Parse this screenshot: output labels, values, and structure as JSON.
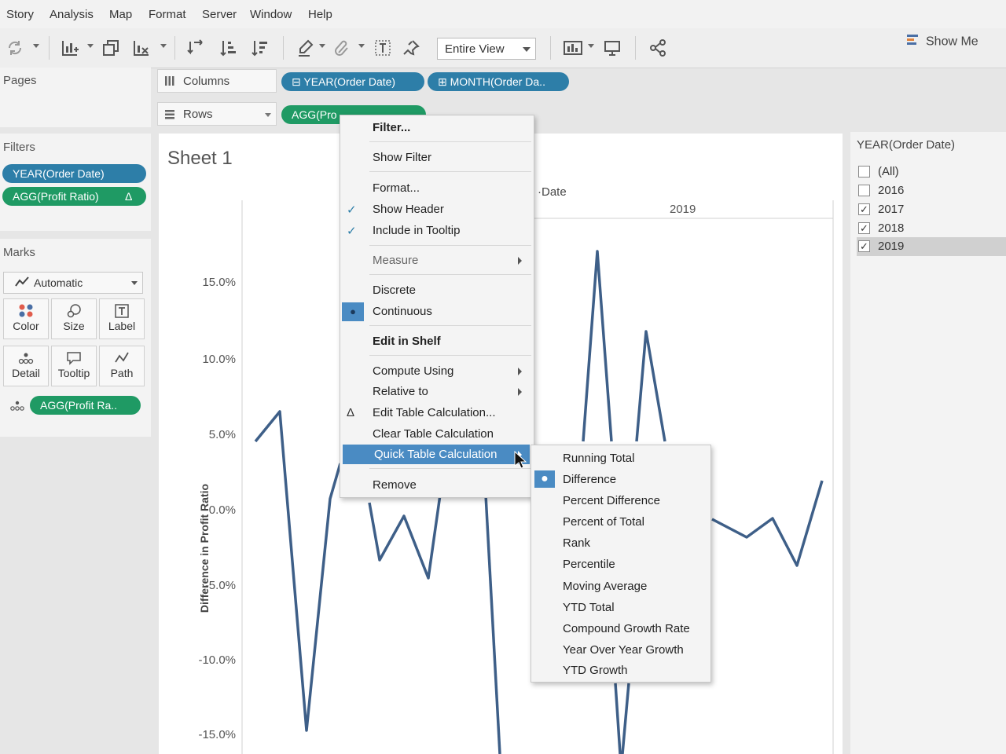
{
  "menu": [
    "Story",
    "Analysis",
    "Map",
    "Format",
    "Server",
    "Window",
    "Help"
  ],
  "toolbar": {
    "fit_value": "Entire View",
    "show_me": "Show Me",
    "icons": [
      "refresh-icon",
      "new-worksheet-icon",
      "duplicate-sheet-icon",
      "clear-sheet-icon",
      "swap-icon",
      "sort-ascending-icon",
      "sort-descending-icon",
      "highlight-icon",
      "group-icon",
      "label-icon",
      "pin-icon",
      "presentation-icon",
      "share-icon"
    ]
  },
  "pages": {
    "title": "Pages"
  },
  "filters": {
    "title": "Filters",
    "pills": [
      "YEAR(Order Date)",
      "AGG(Profit Ratio)"
    ],
    "pill_delta": "Δ"
  },
  "marks": {
    "title": "Marks",
    "type": "Automatic",
    "buttons": [
      "Color",
      "Size",
      "Label",
      "Detail",
      "Tooltip",
      "Path"
    ],
    "pill": "AGG(Profit Ra.."
  },
  "shelves": {
    "columns_label": "Columns",
    "rows_label": "Rows",
    "columns_pills": [
      "YEAR(Order Date)",
      "MONTH(Order Da.."
    ],
    "rows_pill": "AGG(Pro"
  },
  "sheet": {
    "title": "Sheet 1",
    "header_partial": "Date",
    "year_header": "2019",
    "y_axis_label": "Difference in Profit Ratio",
    "y_ticks": [
      "15.0%",
      "10.0%",
      "5.0%",
      "0.0%",
      "-5.0%",
      "-10.0%",
      "-15.0%"
    ]
  },
  "chart_data": {
    "type": "line",
    "ylabel": "Difference in Profit Ratio",
    "ylim": [
      -15.0,
      15.0
    ],
    "line_color": "#3e5f88"
  },
  "year_filter": {
    "title": "YEAR(Order Date)",
    "items": [
      {
        "label": "(All)",
        "checked": false
      },
      {
        "label": "2016",
        "checked": false
      },
      {
        "label": "2017",
        "checked": true
      },
      {
        "label": "2018",
        "checked": true
      },
      {
        "label": "2019",
        "checked": true
      }
    ],
    "check_glyph": "✓"
  },
  "context_menu": {
    "items": [
      "Filter...",
      "Show Filter",
      "Format...",
      "Show Header",
      "Include in Tooltip",
      "Measure",
      "Discrete",
      "Continuous",
      "Edit in Shelf",
      "Compute Using",
      "Relative to",
      "Edit Table Calculation...",
      "Clear Table Calculation",
      "Quick Table Calculation",
      "Remove"
    ],
    "check_glyph": "✓",
    "dot_glyph": "●",
    "delta_glyph": "Δ"
  },
  "submenu": {
    "items": [
      "Running Total",
      "Difference",
      "Percent Difference",
      "Percent of Total",
      "Rank",
      "Percentile",
      "Moving Average",
      "YTD Total",
      "Compound Growth Rate",
      "Year Over Year Growth",
      "YTD Growth"
    ],
    "dot_glyph": "●"
  }
}
